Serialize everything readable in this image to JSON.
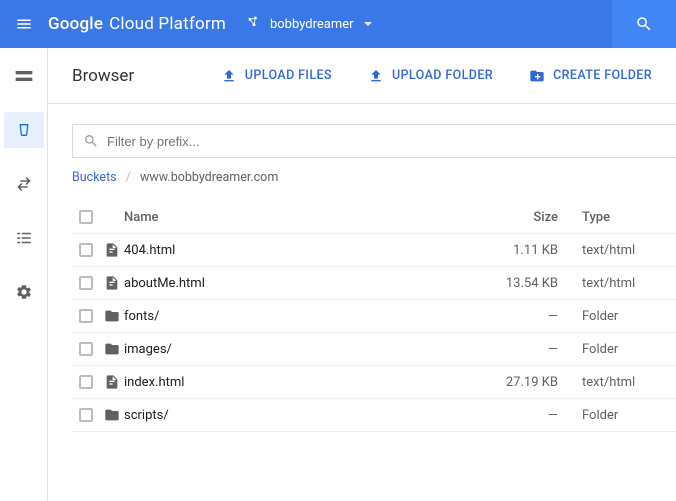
{
  "topbar": {
    "brand_google": "Google",
    "brand_rest": "Cloud Platform",
    "project": "bobbydreamer"
  },
  "toolbar": {
    "title": "Browser",
    "upload_files": "UPLOAD FILES",
    "upload_folder": "UPLOAD FOLDER",
    "create_folder": "CREATE FOLDER"
  },
  "filter": {
    "placeholder": "Filter by prefix..."
  },
  "breadcrumb": {
    "root": "Buckets",
    "current": "www.bobbydreamer.com"
  },
  "columns": {
    "name": "Name",
    "size": "Size",
    "type": "Type"
  },
  "rows": [
    {
      "kind": "file",
      "name": "404.html",
      "size": "1.11 KB",
      "type": "text/html"
    },
    {
      "kind": "file",
      "name": "aboutMe.html",
      "size": "13.54 KB",
      "type": "text/html"
    },
    {
      "kind": "folder",
      "name": "fonts/",
      "size": "—",
      "type": "Folder"
    },
    {
      "kind": "folder",
      "name": "images/",
      "size": "—",
      "type": "Folder"
    },
    {
      "kind": "file",
      "name": "index.html",
      "size": "27.19 KB",
      "type": "text/html"
    },
    {
      "kind": "folder",
      "name": "scripts/",
      "size": "—",
      "type": "Folder"
    }
  ]
}
